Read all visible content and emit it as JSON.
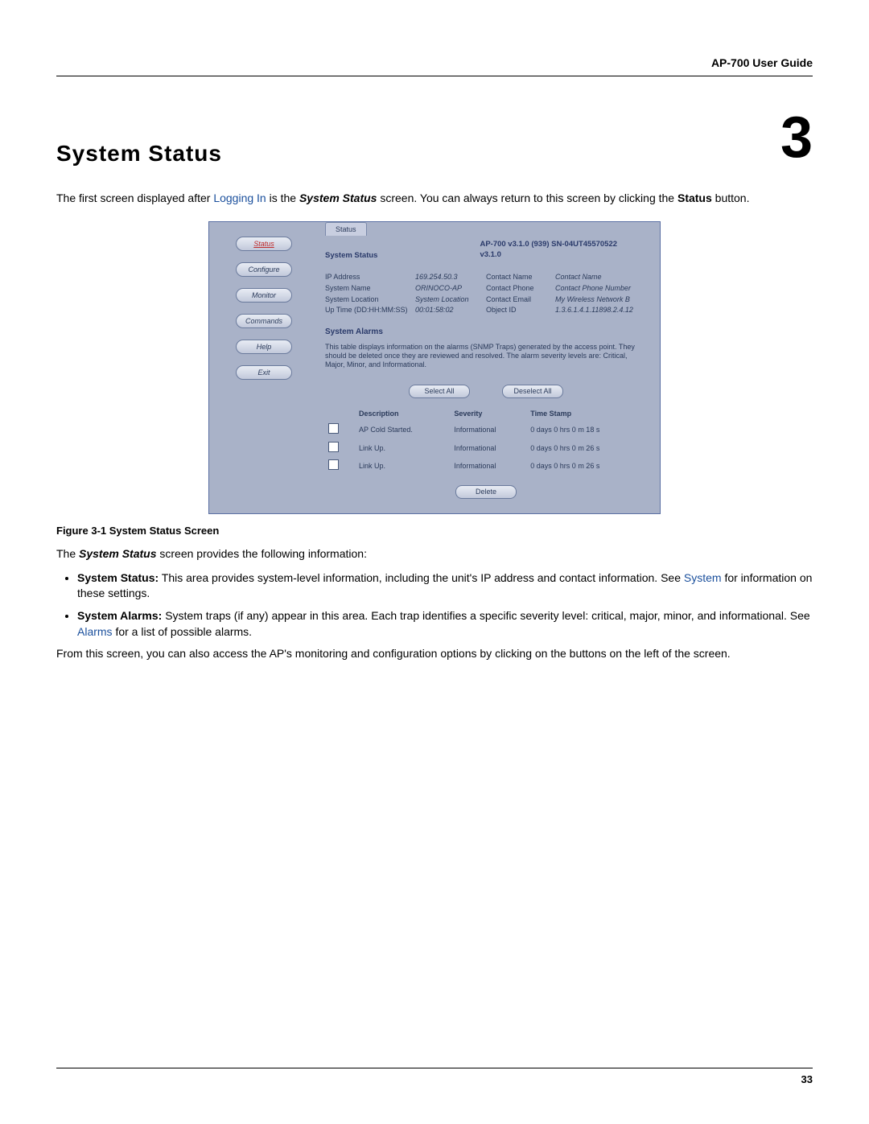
{
  "header": {
    "guide_title": "AP-700 User Guide"
  },
  "chapter": {
    "title": "System Status",
    "number": "3"
  },
  "intro": {
    "part1": "The first screen displayed after ",
    "link": "Logging In",
    "part2": " is the ",
    "bold_italic": "System Status",
    "part3": " screen. You can always return to this screen by clicking the ",
    "bold": "Status",
    "part4": " button."
  },
  "screenshot": {
    "tab": "Status",
    "sidebar": {
      "status": "Status",
      "configure": "Configure",
      "monitor": "Monitor",
      "commands": "Commands",
      "help": "Help",
      "exit": "Exit"
    },
    "section_status": "System Status",
    "version_line": "AP-700  v3.1.0  (939)  SN-04UT45570522",
    "version_sub": "v3.1.0",
    "info_left_labels": {
      "ip": "IP Address",
      "name": "System Name",
      "loc": "System Location",
      "uptime": "Up Time (DD:HH:MM:SS)"
    },
    "info_left_values": {
      "ip": "169.254.50.3",
      "name": "ORINOCO-AP",
      "loc": "System Location",
      "uptime": "00:01:58:02"
    },
    "info_right_labels": {
      "cname": "Contact Name",
      "cphone": "Contact Phone",
      "cemail": "Contact Email",
      "oid": "Object ID"
    },
    "info_right_values": {
      "cname": "Contact Name",
      "cphone": "Contact Phone Number",
      "cemail": "My Wireless Network B",
      "oid": "1.3.6.1.4.1.11898.2.4.12"
    },
    "section_alarms": "System Alarms",
    "alarms_desc": "This table displays information on the alarms (SNMP Traps) generated by the access point. They should be deleted once they are reviewed and resolved. The alarm severity levels are: Critical, Major, Minor, and Informational.",
    "btn_select_all": "Select All",
    "btn_deselect_all": "Deselect All",
    "table": {
      "h_desc": "Description",
      "h_sev": "Severity",
      "h_ts": "Time Stamp",
      "rows": [
        {
          "desc": "AP Cold Started.",
          "sev": "Informational",
          "ts": "0 days 0 hrs 0 m 18 s"
        },
        {
          "desc": "Link Up.",
          "sev": "Informational",
          "ts": "0 days 0 hrs 0 m 26 s"
        },
        {
          "desc": "Link Up.",
          "sev": "Informational",
          "ts": "0 days 0 hrs 0 m 26 s"
        }
      ]
    },
    "btn_delete": "Delete"
  },
  "figure_caption": "Figure 3-1 System Status Screen",
  "para2": {
    "part1": "The ",
    "bold_italic": "System Status",
    "part2": " screen provides the following information:"
  },
  "bullets": {
    "b1": {
      "label": "System Status:",
      "text": " This area provides system-level information, including the unit's IP address and contact information. See ",
      "link": "System",
      "tail": " for information on these settings."
    },
    "b2": {
      "label": "System Alarms:",
      "text": " System traps (if any) appear in this area. Each trap identifies a specific severity level: critical, major, minor, and informational. See ",
      "link": "Alarms",
      "tail": " for a list of possible alarms."
    }
  },
  "para3": "From this screen, you can also access the AP's monitoring and configuration options by clicking on the buttons on the left of the screen.",
  "footer": {
    "page": "33"
  }
}
